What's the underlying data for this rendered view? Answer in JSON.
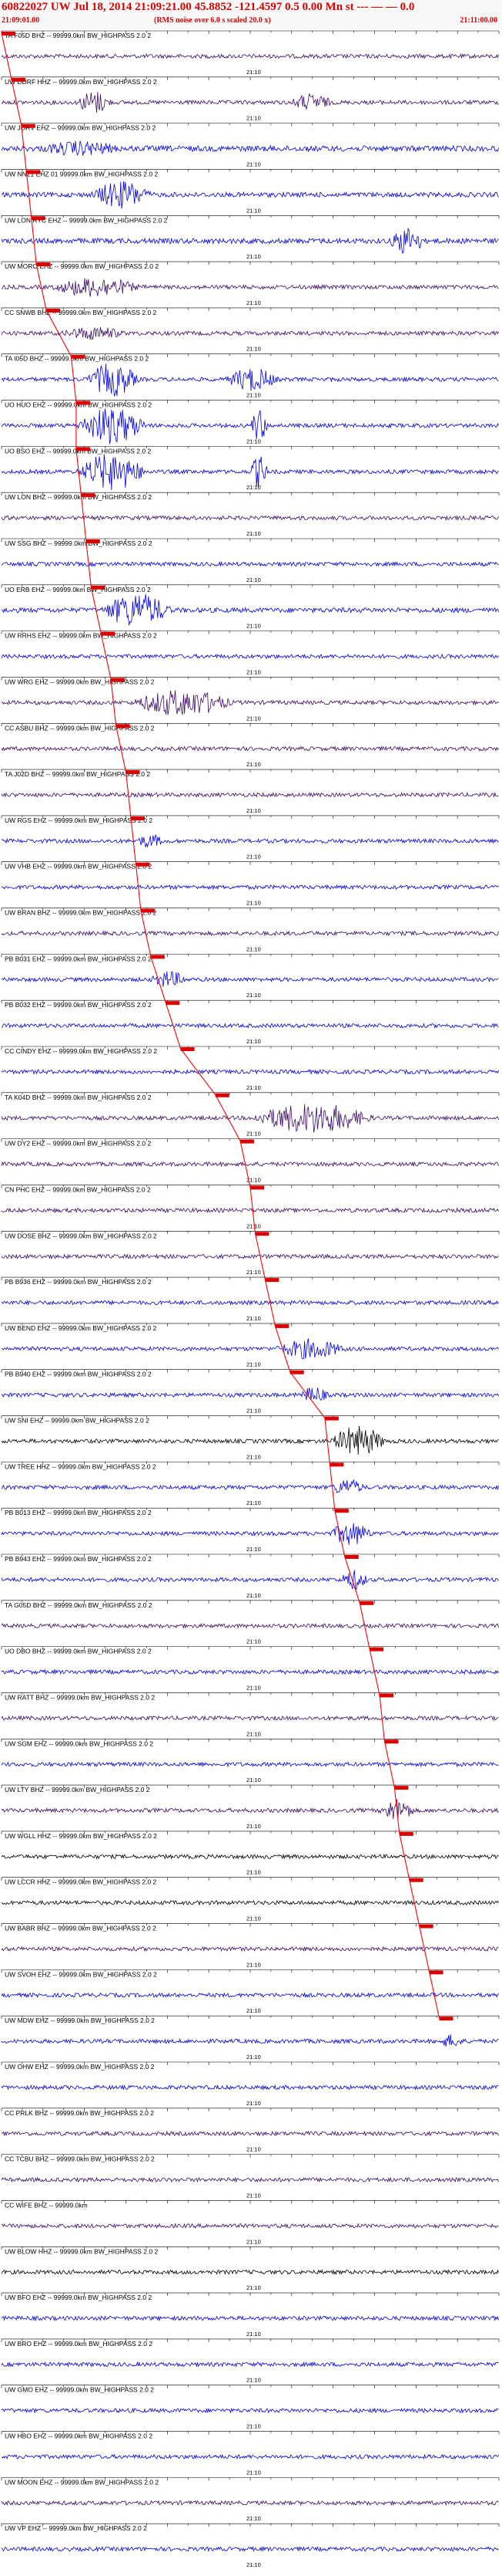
{
  "header": {
    "title": "60822027 UW Jul 18, 2014 21:09:21.00   45.8852 -121.4597   0.5 0.00 Mn st",
    "title_tail": "--- — — 0.0",
    "start_time": "21:09:01.00",
    "note": "(RMS noise over 6.0 s scaled 20.0 x)",
    "end_time": "21:11:00.00"
  },
  "colors": {
    "header_text": "#e00000",
    "blue_trace": "#0000ee",
    "purple_trace": "#3a0a6a",
    "black_trace": "#000000",
    "pick_marker": "#dd0000",
    "pick_line": "#ff0000"
  },
  "time_marker_label": "21:10",
  "chart_data": {
    "type": "seismogram",
    "time_window": {
      "start": "21:09:01.00",
      "end": "21:11:00.00"
    },
    "traces": [
      {
        "label": "TA F05D BHZ -- 99999.0km BW_HIGHPASS  2.0  2",
        "color": "purple",
        "amp": 1.0,
        "events": [],
        "pick": 0.0
      },
      {
        "label": "UW DDRF HHZ -- 99999.0km BW_HIGHPASS  2.0  2",
        "color": "purple",
        "amp": 1.0,
        "events": [
          [
            0.15,
            0.25,
            6
          ],
          [
            0.58,
            0.7,
            4
          ]
        ],
        "pick": 0.02
      },
      {
        "label": "UW JORV EHZ -- 99999.0km BW_HIGHPASS  2.0  2",
        "color": "blue",
        "amp": 1.4,
        "events": [
          [
            0.08,
            0.3,
            3
          ]
        ],
        "pick": 0.04
      },
      {
        "label": "UW NN21 EHZ 01 99999.0km BW_HIGHPASS  2.0  2",
        "color": "blue",
        "amp": 1.2,
        "events": [
          [
            0.18,
            0.35,
            7
          ]
        ],
        "pick": 0.05
      },
      {
        "label": "UW LON RYC EHZ -- 99999.0km BW_HIGHPASS  2.0  2",
        "color": "blue",
        "amp": 1.3,
        "events": [
          [
            0.78,
            0.88,
            7
          ]
        ],
        "pick": 0.06
      },
      {
        "label": "UW MORO EHZ -- 99999.0km BW_HIGHPASS  2.0  2",
        "color": "purple",
        "amp": 1.0,
        "events": [
          [
            0.1,
            0.35,
            5
          ]
        ],
        "pick": 0.07
      },
      {
        "label": "CC SNWB BHZ -- 99999.0km BW_HIGHPASS  2.0  2",
        "color": "purple",
        "amp": 1.0,
        "events": [
          [
            0.12,
            0.3,
            3
          ]
        ],
        "pick": 0.09
      },
      {
        "label": "TA I05D BHZ -- 99999.0km BW_HIGHPASS  2.0  2",
        "color": "blue",
        "amp": 1.0,
        "events": [
          [
            0.17,
            0.32,
            9
          ],
          [
            0.45,
            0.6,
            6
          ]
        ],
        "pick": 0.14
      },
      {
        "label": "UO HUO EHZ -- 99999.0km BW_HIGHPASS  2.0  2",
        "color": "blue",
        "amp": 1.0,
        "events": [
          [
            0.15,
            0.35,
            10
          ],
          [
            0.5,
            0.55,
            9
          ]
        ],
        "pick": 0.15
      },
      {
        "label": "UO BSO EHZ -- 99999.0km BW_HIGHPASS  2.0  2",
        "color": "blue",
        "amp": 1.0,
        "events": [
          [
            0.15,
            0.35,
            10
          ],
          [
            0.5,
            0.55,
            9
          ]
        ],
        "pick": 0.15
      },
      {
        "label": "UW LON BHZ -- 99999.0km BW_HIGHPASS  2.0  2",
        "color": "purple",
        "amp": 1.0,
        "events": [],
        "pick": 0.16
      },
      {
        "label": "UW SSG BHZ -- 99999.0km BW_HIGHPASS  2.0  2",
        "color": "blue",
        "amp": 1.0,
        "events": [],
        "pick": 0.17
      },
      {
        "label": "UO ERB EHZ -- 99999.0km BW_HIGHPASS  2.0  2",
        "color": "blue",
        "amp": 1.2,
        "events": [
          [
            0.2,
            0.4,
            9
          ]
        ],
        "pick": 0.18
      },
      {
        "label": "UW RRHS EHZ -- 99999.0km BW_HIGHPASS  2.0  2",
        "color": "blue",
        "amp": 1.0,
        "events": [],
        "pick": 0.2
      },
      {
        "label": "UW WRG EHZ -- 99999.0km BW_HIGHPASS  2.0  2",
        "color": "purple",
        "amp": 1.0,
        "events": [
          [
            0.26,
            0.55,
            7
          ]
        ],
        "pick": 0.22
      },
      {
        "label": "CC ASBU BHZ -- 99999.0km BW_HIGHPASS  2.0  2",
        "color": "purple",
        "amp": 1.0,
        "events": [],
        "pick": 0.23
      },
      {
        "label": "TA J02D BHZ -- 99999.0km BW_HIGHPASS  2.0  2",
        "color": "purple",
        "amp": 1.0,
        "events": [],
        "pick": 0.25
      },
      {
        "label": "UW RGS EHZ -- 99999.0km BW_HIGHPASS  2.0  2",
        "color": "blue",
        "amp": 1.0,
        "events": [
          [
            0.27,
            0.35,
            3
          ]
        ],
        "pick": 0.26
      },
      {
        "label": "UW VHB EHZ -- 99999.0km BW_HIGHPASS  2.0  2",
        "color": "blue",
        "amp": 1.0,
        "events": [],
        "pick": 0.27
      },
      {
        "label": "UW BRAN BHZ -- 99999.0km BW_HIGHPASS  2.0  2",
        "color": "purple",
        "amp": 1.0,
        "events": [],
        "pick": 0.28
      },
      {
        "label": "PB B031 EHZ -- 99999.0km BW_HIGHPASS  2.0  2",
        "color": "blue",
        "amp": 1.0,
        "events": [
          [
            0.3,
            0.4,
            4
          ]
        ],
        "pick": 0.3
      },
      {
        "label": "PB B032 EHZ -- 99999.0km BW_HIGHPASS  2.0  2",
        "color": "blue",
        "amp": 1.0,
        "events": [],
        "pick": 0.33
      },
      {
        "label": "CC CINDY EHZ -- 99999.0km BW_HIGHPASS  2.0  2",
        "color": "blue",
        "amp": 1.0,
        "events": [],
        "pick": 0.36
      },
      {
        "label": "TA K04D BHZ -- 99999.0km BW_HIGHPASS  2.0  2",
        "color": "purple",
        "amp": 1.0,
        "events": [
          [
            0.5,
            0.85,
            8
          ]
        ],
        "pick": 0.43
      },
      {
        "label": "UW DY2 EHZ -- 99999.0km BW_HIGHPASS  2.0  2",
        "color": "purple",
        "amp": 1.0,
        "events": [],
        "pick": 0.48
      },
      {
        "label": "CN PHC EHZ -- 99999.0km BW_HIGHPASS  2.0  2",
        "color": "purple",
        "amp": 1.0,
        "events": [],
        "pick": 0.5
      },
      {
        "label": "UW DOSE BHZ -- 99999.0km BW_HIGHPASS  2.0  2",
        "color": "purple",
        "amp": 1.0,
        "events": [],
        "pick": 0.51
      },
      {
        "label": "PB B936 EHZ -- 99999.0km BW_HIGHPASS  2.0  2",
        "color": "blue",
        "amp": 1.0,
        "events": [],
        "pick": 0.53
      },
      {
        "label": "UW BEND EHZ -- 99999.0km BW_HIGHPASS  2.0  2",
        "color": "blue",
        "amp": 1.0,
        "events": [
          [
            0.55,
            0.75,
            5
          ]
        ],
        "pick": 0.55
      },
      {
        "label": "PB B940 EHZ -- 99999.0km BW_HIGHPASS  2.0  2",
        "color": "blue",
        "amp": 1.0,
        "events": [
          [
            0.6,
            0.68,
            4
          ]
        ],
        "pick": 0.58
      },
      {
        "label": "UW SNI EHZ -- 99999.0km BW_HIGHPASS  2.0  2",
        "color": "black",
        "amp": 1.0,
        "events": [
          [
            0.66,
            0.82,
            8
          ]
        ],
        "pick": 0.65
      },
      {
        "label": "UW TREE HHZ -- 99999.0km BW_HIGHPASS  2.0  2",
        "color": "blue",
        "amp": 1.0,
        "events": [
          [
            0.66,
            0.76,
            4
          ]
        ],
        "pick": 0.66
      },
      {
        "label": "PB B013 EHZ -- 99999.0km BW_HIGHPASS  2.0  2",
        "color": "blue",
        "amp": 1.0,
        "events": [
          [
            0.66,
            0.78,
            6
          ]
        ],
        "pick": 0.67
      },
      {
        "label": "PB B943 EHZ -- 99999.0km BW_HIGHPASS  2.0  2",
        "color": "blue",
        "amp": 1.0,
        "events": [
          [
            0.68,
            0.76,
            5
          ]
        ],
        "pick": 0.69
      },
      {
        "label": "TA G05D BHZ -- 99999.0km BW_HIGHPASS  2.0  2",
        "color": "purple",
        "amp": 1.0,
        "events": [],
        "pick": 0.72
      },
      {
        "label": "UO DBO BHZ -- 99999.0km BW_HIGHPASS  2.0  2",
        "color": "blue",
        "amp": 1.0,
        "events": [],
        "pick": 0.74
      },
      {
        "label": "UW RATT BHZ -- 99999.0km BW_HIGHPASS  2.0  2",
        "color": "purple",
        "amp": 1.0,
        "events": [],
        "pick": 0.76
      },
      {
        "label": "UW SGM EHZ -- 99999.0km BW_HIGHPASS  2.0  2",
        "color": "blue",
        "amp": 1.0,
        "events": [],
        "pick": 0.77
      },
      {
        "label": "UW LTY BHZ -- 99999.0km BW_HIGHPASS  2.0  2",
        "color": "purple",
        "amp": 1.0,
        "events": [
          [
            0.76,
            0.86,
            6
          ]
        ],
        "pick": 0.79
      },
      {
        "label": "UW WGLL HHZ -- 99999.0km BW_HIGHPASS  2.0  2",
        "color": "black",
        "amp": 1.0,
        "events": [],
        "pick": 0.8
      },
      {
        "label": "UW LCCR HHZ -- 99999.0km BW_HIGHPASS  2.0  2",
        "color": "black",
        "amp": 1.0,
        "events": [],
        "pick": 0.82
      },
      {
        "label": "UW BABR BHZ -- 99999.0km BW_HIGHPASS  2.0  2",
        "color": "purple",
        "amp": 1.0,
        "events": [],
        "pick": 0.84
      },
      {
        "label": "UW SVOH EHZ -- 99999.0km BW_HIGHPASS  2.0  2",
        "color": "blue",
        "amp": 1.0,
        "events": [],
        "pick": 0.86
      },
      {
        "label": "UW MDW EHZ -- 99999.0km BW_HIGHPASS  2.0  2",
        "color": "blue",
        "amp": 1.0,
        "events": [
          [
            0.88,
            0.95,
            3
          ]
        ],
        "pick": 0.88
      },
      {
        "label": "UW OHW EHZ -- 99999.0km BW_HIGHPASS  2.0  2",
        "color": "blue",
        "amp": 1.0,
        "events": [],
        "pick": null
      },
      {
        "label": "CC PRLK BHZ -- 99999.0km BW_HIGHPASS  2.0  2",
        "color": "purple",
        "amp": 1.0,
        "events": [],
        "pick": null
      },
      {
        "label": "CC TCBU BHZ -- 99999.0km BW_HIGHPASS  2.0  2",
        "color": "purple",
        "amp": 1.0,
        "events": [],
        "pick": null
      },
      {
        "label": "CC WIFE BHZ -- 99999.0km",
        "color": "purple",
        "amp": 1.0,
        "events": [],
        "pick": null
      },
      {
        "label": "UW BLOW HHZ -- 99999.0km BW_HIGHPASS  2.0  2",
        "color": "black",
        "amp": 1.0,
        "events": [],
        "pick": null
      },
      {
        "label": "UW BFO EHZ -- 99999.0km BW_HIGHPASS  2.0  2",
        "color": "blue",
        "amp": 1.0,
        "events": [],
        "pick": null
      },
      {
        "label": "UW BRO EHZ -- 99999.0km BW_HIGHPASS  2.0  2",
        "color": "blue",
        "amp": 1.0,
        "events": [],
        "pick": null
      },
      {
        "label": "UW GMO EHZ -- 99999.0km BW_HIGHPASS  2.0  2",
        "color": "blue",
        "amp": 1.0,
        "events": [],
        "pick": null
      },
      {
        "label": "UW HBO EHZ -- 99999.0km BW_HIGHPASS  2.0  2",
        "color": "blue",
        "amp": 1.0,
        "events": [],
        "pick": null
      },
      {
        "label": "UW MOON EHZ -- 99999.0km BW_HIGHPASS  2.0  2",
        "color": "purple",
        "amp": 1.0,
        "events": [],
        "pick": null
      },
      {
        "label": "UW VP EHZ -- 99999.0km BW_HIGHPASS  2.0  2",
        "color": "blue",
        "amp": 1.0,
        "events": [],
        "pick": null
      }
    ]
  }
}
